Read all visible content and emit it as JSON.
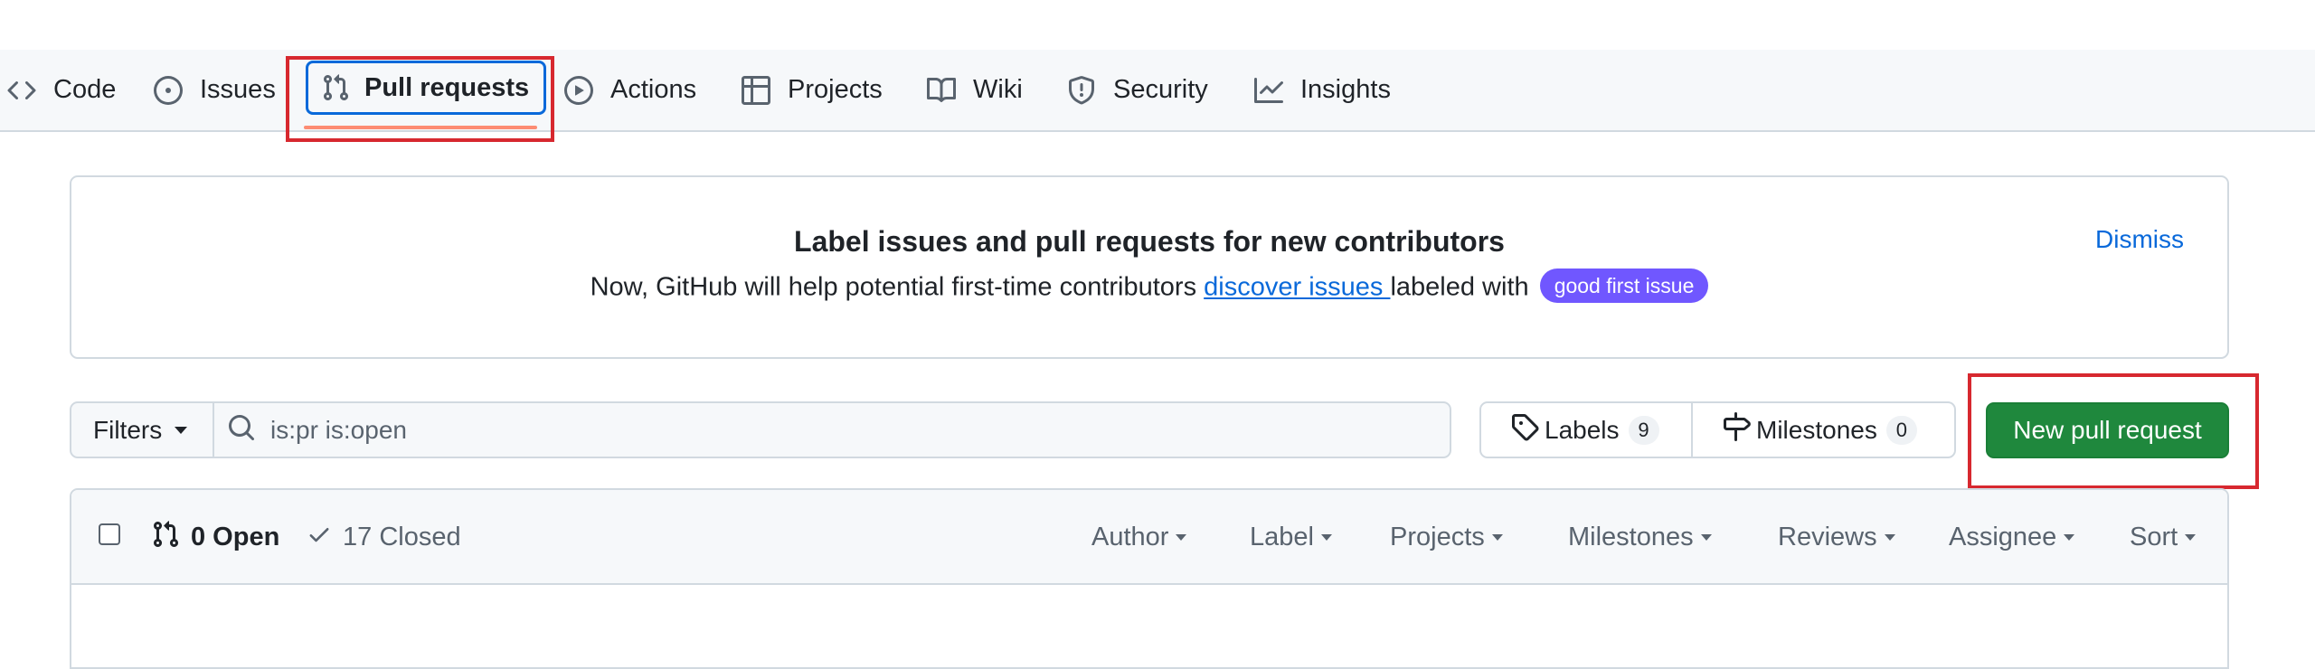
{
  "nav": {
    "tabs": [
      {
        "label": "Code",
        "icon": "code-icon"
      },
      {
        "label": "Issues",
        "icon": "issue-opened-icon"
      },
      {
        "label": "Pull requests",
        "icon": "git-pull-request-icon",
        "selected": true
      },
      {
        "label": "Actions",
        "icon": "play-icon"
      },
      {
        "label": "Projects",
        "icon": "table-icon"
      },
      {
        "label": "Wiki",
        "icon": "book-icon"
      },
      {
        "label": "Security",
        "icon": "shield-icon"
      },
      {
        "label": "Insights",
        "icon": "graph-icon"
      }
    ]
  },
  "banner": {
    "title": "Label issues and pull requests for new contributors",
    "text_before": "Now, GitHub will help potential first-time contributors ",
    "link": "discover issues ",
    "text_after": "labeled with ",
    "chip": "good first issue",
    "chip_color": "#7057ff",
    "dismiss": "Dismiss"
  },
  "filters": {
    "button": "Filters",
    "search_value": "is:pr is:open"
  },
  "labels_button": {
    "label": "Labels",
    "count": "9"
  },
  "milestones_button": {
    "label": "Milestones",
    "count": "0"
  },
  "new_pr_button": {
    "label": "New pull request",
    "color": "#1f883d"
  },
  "list": {
    "open_label": "0 Open",
    "closed_label": "17 Closed",
    "dropdowns": [
      "Author",
      "Label",
      "Projects",
      "Milestones",
      "Reviews",
      "Assignee",
      "Sort"
    ]
  },
  "colors": {
    "accent": "#0969da",
    "underline": "#fd8c73",
    "highlight": "#d7282f"
  }
}
